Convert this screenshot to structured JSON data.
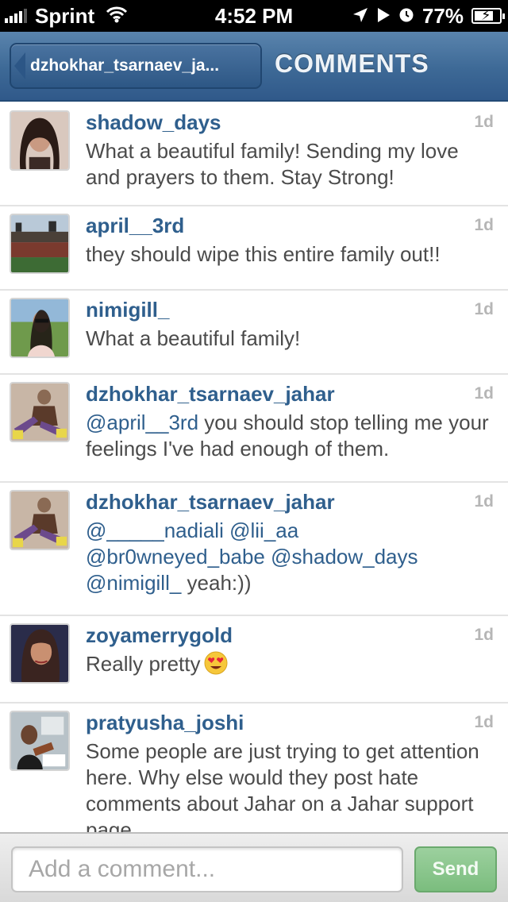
{
  "status_bar": {
    "carrier": "Sprint",
    "time": "4:52 PM",
    "battery": "77%",
    "battery_level": 0.77
  },
  "nav": {
    "back_label": "dzhokhar_tsarnaev_ja...",
    "title": "COMMENTS"
  },
  "comments": [
    {
      "username": "shadow_days",
      "time": "1d",
      "text": "What a beautiful family! Sending my love and prayers to them. Stay Strong!"
    },
    {
      "username": "april__3rd",
      "time": "1d",
      "text": "they should wipe this entire family out!!"
    },
    {
      "username": "nimigill_",
      "time": "1d",
      "text": "What a beautiful family!"
    },
    {
      "username": "dzhokhar_tsarnaev_jahar",
      "time": "1d",
      "mention": "@april__3rd",
      "text": " you should stop telling me your feelings I've had enough of them."
    },
    {
      "username": "dzhokhar_tsarnaev_jahar",
      "time": "1d",
      "mentions": [
        "@_____nadiali",
        "@lii_aa",
        "@br0wneyed_babe",
        "@shadow_days",
        "@nimigill_"
      ],
      "text": " yeah:))"
    },
    {
      "username": "zoyamerrygold",
      "time": "1d",
      "text": "Really pretty",
      "emoji": "heart-eyes-emoji"
    },
    {
      "username": "pratyusha_joshi",
      "time": "1d",
      "text": "Some people are just trying to get attention here. Why else would they post hate comments about Jahar on a Jahar support page"
    }
  ],
  "input": {
    "placeholder": "Add a comment...",
    "send_label": "Send"
  },
  "colors": {
    "navbar": "#3d6996",
    "username": "#2f5f8d",
    "send_button": "#7bbd7e"
  }
}
